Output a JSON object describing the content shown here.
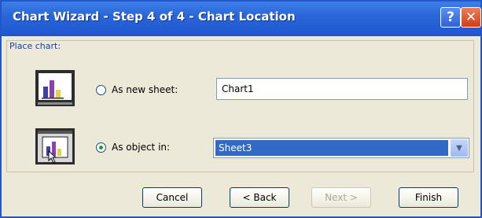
{
  "window": {
    "title": "Chart Wizard - Step 4 of 4 - Chart Location",
    "help_glyph": "?",
    "close_glyph": "✕"
  },
  "group": {
    "label": "Place chart:"
  },
  "options": [
    {
      "label": "As new sheet:",
      "checked": false,
      "value": "Chart1"
    },
    {
      "label": "As object in:",
      "checked": true,
      "value": "Sheet3"
    }
  ],
  "buttons": {
    "cancel": "Cancel",
    "back": "< Back",
    "next": "Next >",
    "finish": "Finish"
  },
  "icons": [
    "new-sheet-chart-icon",
    "object-in-sheet-chart-icon",
    "chevron-down-icon",
    "help-icon",
    "close-icon"
  ],
  "colors": {
    "title_bar": "#2b66d8",
    "selection": "#316ac5",
    "close": "#d23d15"
  }
}
